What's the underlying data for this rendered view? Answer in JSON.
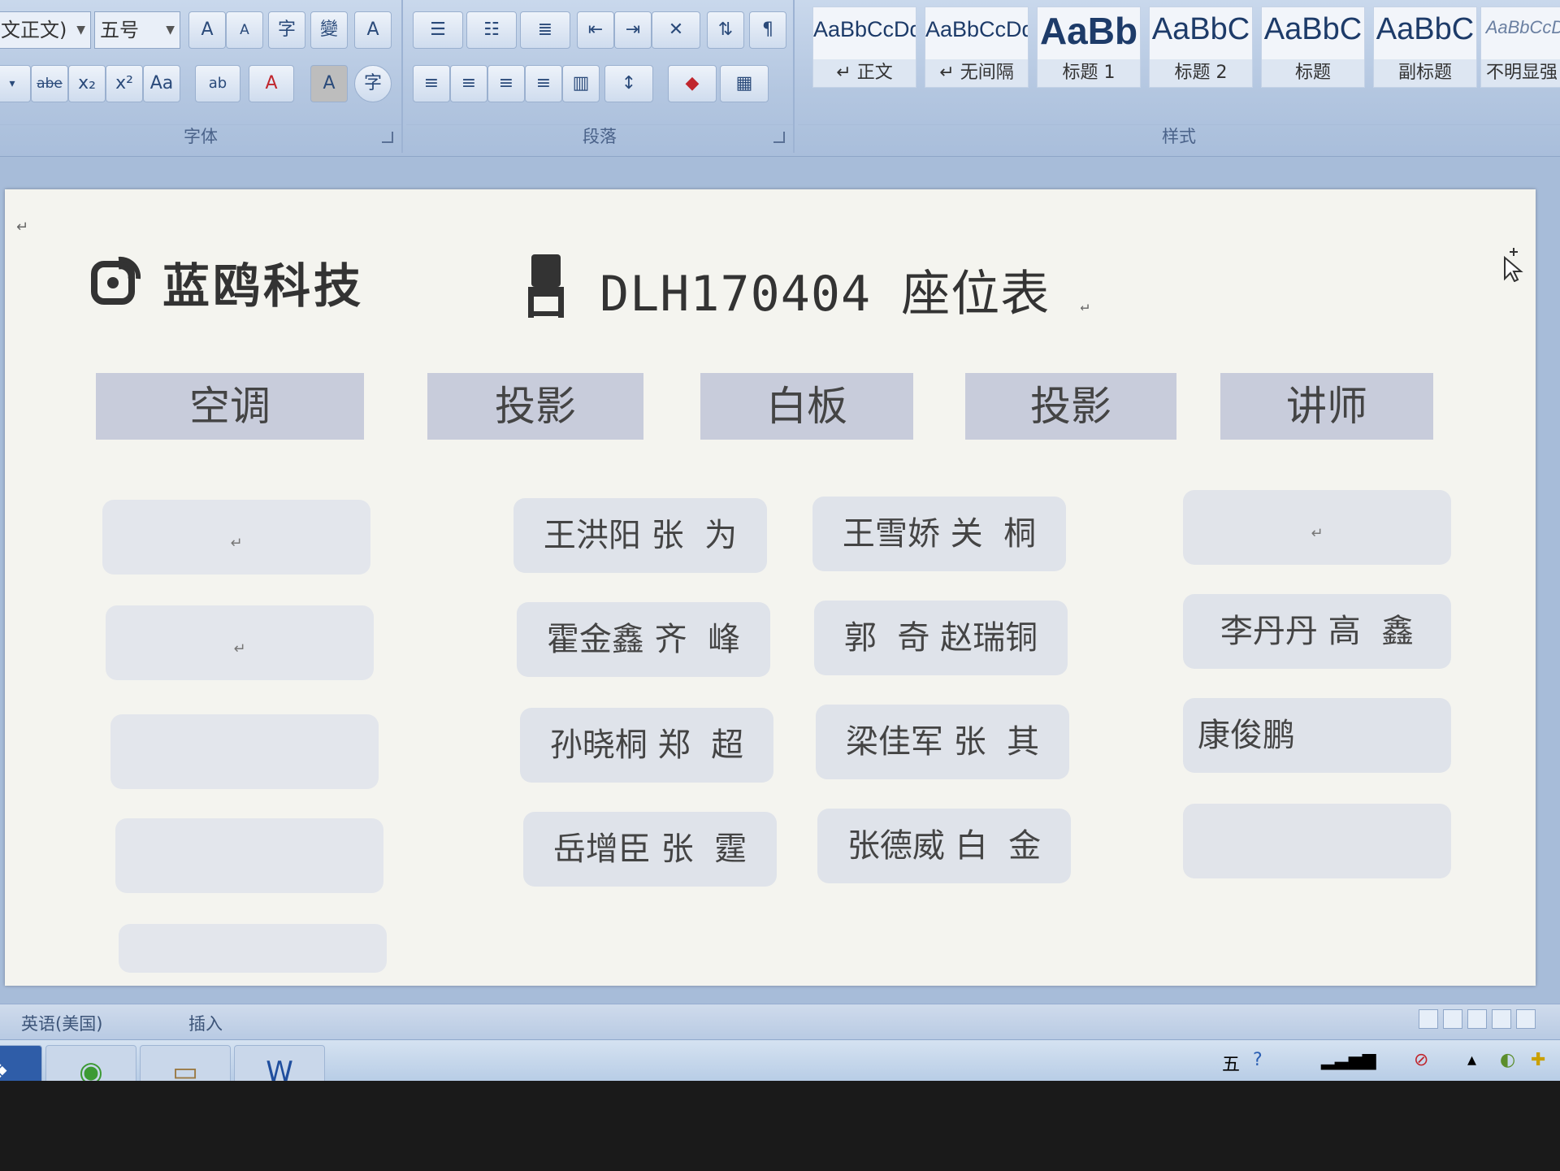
{
  "ribbon": {
    "font_group": {
      "label": "字体",
      "font_name": "文正文)",
      "font_size": "五号",
      "buttons_row1": [
        "A",
        "A",
        "字",
        "變",
        "A"
      ],
      "buttons_row2": [
        "abe",
        "x₂",
        "x²",
        "Aa",
        "ab",
        "A",
        "A",
        "字"
      ]
    },
    "paragraph_group": {
      "label": "段落"
    },
    "styles_group": {
      "label": "样式",
      "tiles": [
        {
          "sample": "AaBbCcDd",
          "name": "↵ 正文"
        },
        {
          "sample": "AaBbCcDd",
          "name": "↵ 无间隔"
        },
        {
          "sample": "AaBb",
          "name": "标题 1"
        },
        {
          "sample": "AaBbC",
          "name": "标题 2"
        },
        {
          "sample": "AaBbC",
          "name": "标题"
        },
        {
          "sample": "AaBbC",
          "name": "副标题"
        },
        {
          "sample": "AaBbCcD",
          "name": "不明显强调"
        }
      ]
    }
  },
  "document": {
    "company": "蓝鸥科技",
    "title": "DLH170404 座位表",
    "headers": [
      "空调",
      "投影",
      "白板",
      "投影",
      "讲师"
    ],
    "center_left_seats": [
      "王洪阳 张  为",
      "霍金鑫 齐  峰",
      "孙晓桐 郑  超",
      "岳增臣 张  霆"
    ],
    "center_right_seats": [
      "王雪娇 关  桐",
      "郭  奇 赵瑞铜",
      "梁佳军 张  其",
      "张德威 白  金"
    ],
    "right_seats": [
      "",
      "李丹丹 高  鑫",
      "康俊鹏",
      ""
    ],
    "return_mark": "↵"
  },
  "statusbar": {
    "language": "英语(美国)",
    "mode": "插入"
  },
  "colors": {
    "ribbon": "#b3c6e0",
    "page": "#f4f4ef",
    "header_box": "#c8ccdb",
    "seat_box": "#dfe3ea"
  }
}
